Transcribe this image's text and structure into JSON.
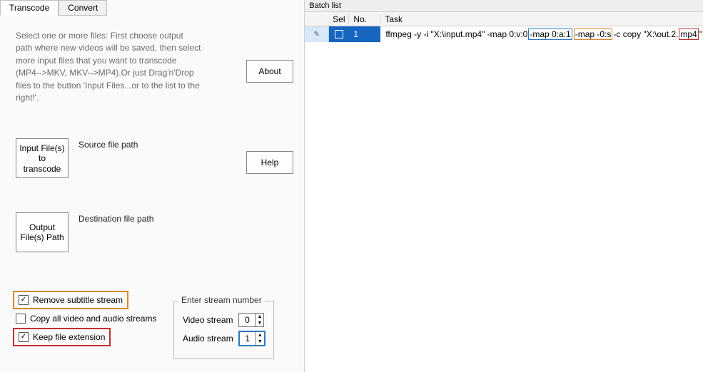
{
  "tabs": {
    "transcode": "Transcode",
    "convert": "Convert"
  },
  "description": "Select one or more files: First choose output path where new videos will be saved, then select more input files that you want to transcode (MP4-->MKV, MKV-->MP4).Or just Drag'n'Drop files to the button 'Input Files...or to the list to the right!'.",
  "buttons": {
    "about": "About",
    "help": "Help",
    "input_files": "Input File(s) to transcode",
    "output_path": "Output File(s) Path"
  },
  "labels": {
    "source_path": "Source file path",
    "dest_path": "Destination file path"
  },
  "checkboxes": {
    "remove_subtitle": {
      "label": "Remove subtitle stream",
      "checked": true
    },
    "copy_all": {
      "label": "Copy all video and audio streams",
      "checked": false
    },
    "keep_ext": {
      "label": "Keep file extension",
      "checked": true
    }
  },
  "stream_group": {
    "legend": "Enter stream number",
    "video_label": "Video stream",
    "audio_label": "Audio stream",
    "video_value": "0",
    "audio_value": "1"
  },
  "batch": {
    "title": "Batch list",
    "headers": {
      "sel": "Sel",
      "no": "No.",
      "task": "Task"
    },
    "row": {
      "no": "1",
      "cmd_prefix": "ffmpeg -y -i \"X:\\input.mp4\"  -map 0:v:0 ",
      "tok_audio": "-map 0:a:1",
      "gap1": " ",
      "tok_subs": "-map -0:s",
      "cmd_mid": " -c copy \"X:\\out.2.",
      "tok_ext": "mp4",
      "cmd_tail": "\""
    }
  }
}
